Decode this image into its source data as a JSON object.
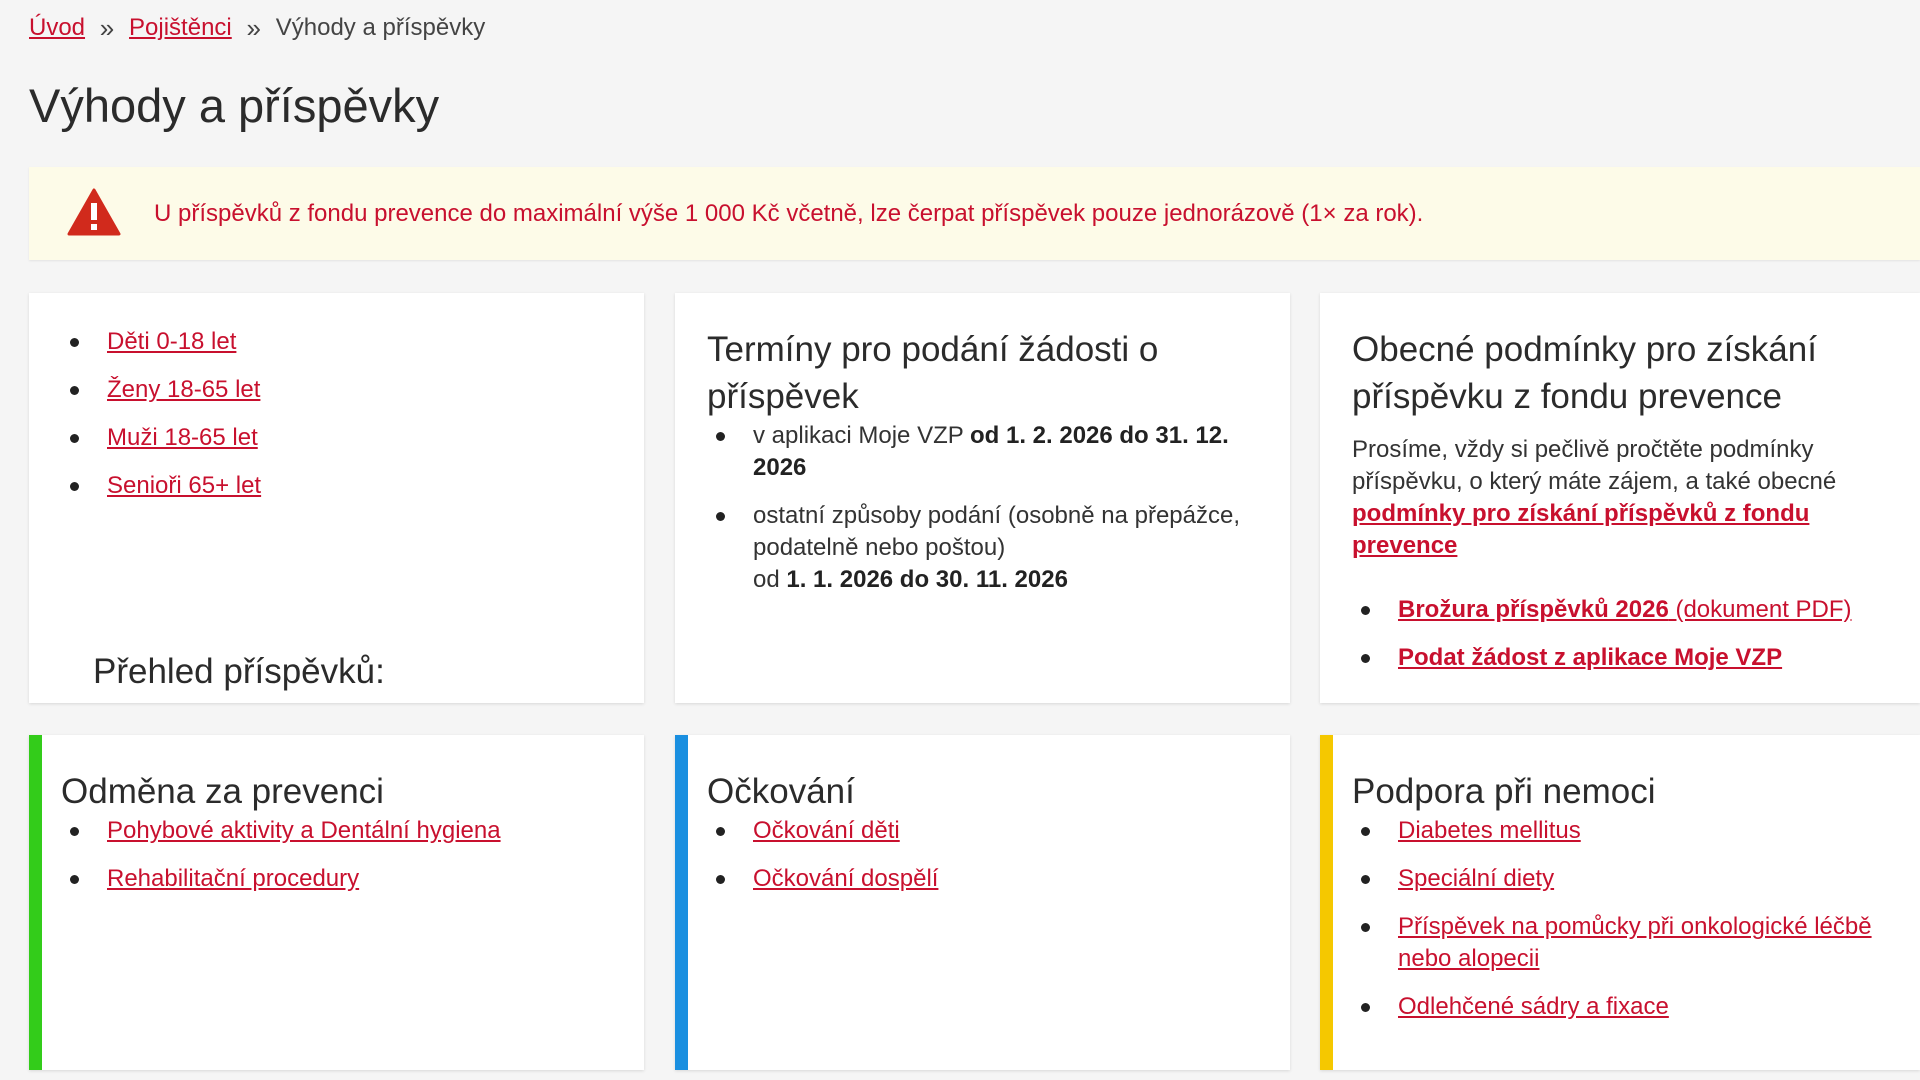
{
  "breadcrumb": {
    "home": "Úvod",
    "insured": "Pojištěnci",
    "current": "Výhody a příspěvky",
    "separator": "»"
  },
  "page_title": "Výhody a příspěvky",
  "alert": {
    "icon": "warning-triangle-icon",
    "text": "U příspěvků z fondu prevence do maximální výše 1 000 Kč včetně, lze čerpat příspěvek pouze jednorázově (1× za rok).",
    "color": "#c8102e",
    "background": "#fdfbe8"
  },
  "cards": {
    "prehled": {
      "title": "Přehled příspěvků:",
      "items": [
        "Děti 0-18 let",
        "Ženy 18-65 let",
        "Muži 18-65 let",
        "Senioři 65+ let"
      ]
    },
    "terminy": {
      "title": "Termíny pro podání žádosti o příspěvek",
      "item1_prefix": "v aplikaci Moje VZP ",
      "item1_bold": "od 1. 2. 2026 do 31. 12. 2026",
      "item2_text": "ostatní způsoby podání (osobně na přepážce, podatelně nebo poštou)",
      "item2_prefix": "od ",
      "item2_bold": "1. 1. 2026 do 30. 11. 2026"
    },
    "podminky": {
      "title": "Obecné podmínky pro získání příspěvku z fondu prevence",
      "text": "Prosíme, vždy si pečlivě pročtěte podmínky příspěvku, o který máte zájem, a také obecné ",
      "link": "podmínky pro získání příspěvků z fondu prevence",
      "item1_bold": "Brožura příspěvků 2026",
      "item1_rest": " (dokument PDF)",
      "item2": "Podat žádost z aplikace Moje VZP"
    },
    "odmena": {
      "title": "Odměna za prevenci",
      "accent": "#33cc1a",
      "items": [
        "Pohybové aktivity a Dentální hygiena",
        "Rehabilitační procedury"
      ]
    },
    "ockovani": {
      "title": "Očkování",
      "accent": "#1a8fe0",
      "items": [
        "Očkování děti",
        "Očkování dospělí"
      ]
    },
    "podpora": {
      "title": "Podpora při nemoci",
      "accent": "#f5c800",
      "items": [
        "Diabetes mellitus",
        "Speciální diety",
        "Příspěvek na pomůcky při onkologické léčbě nebo alopecii",
        "Odlehčené sádry a fixace"
      ]
    }
  }
}
